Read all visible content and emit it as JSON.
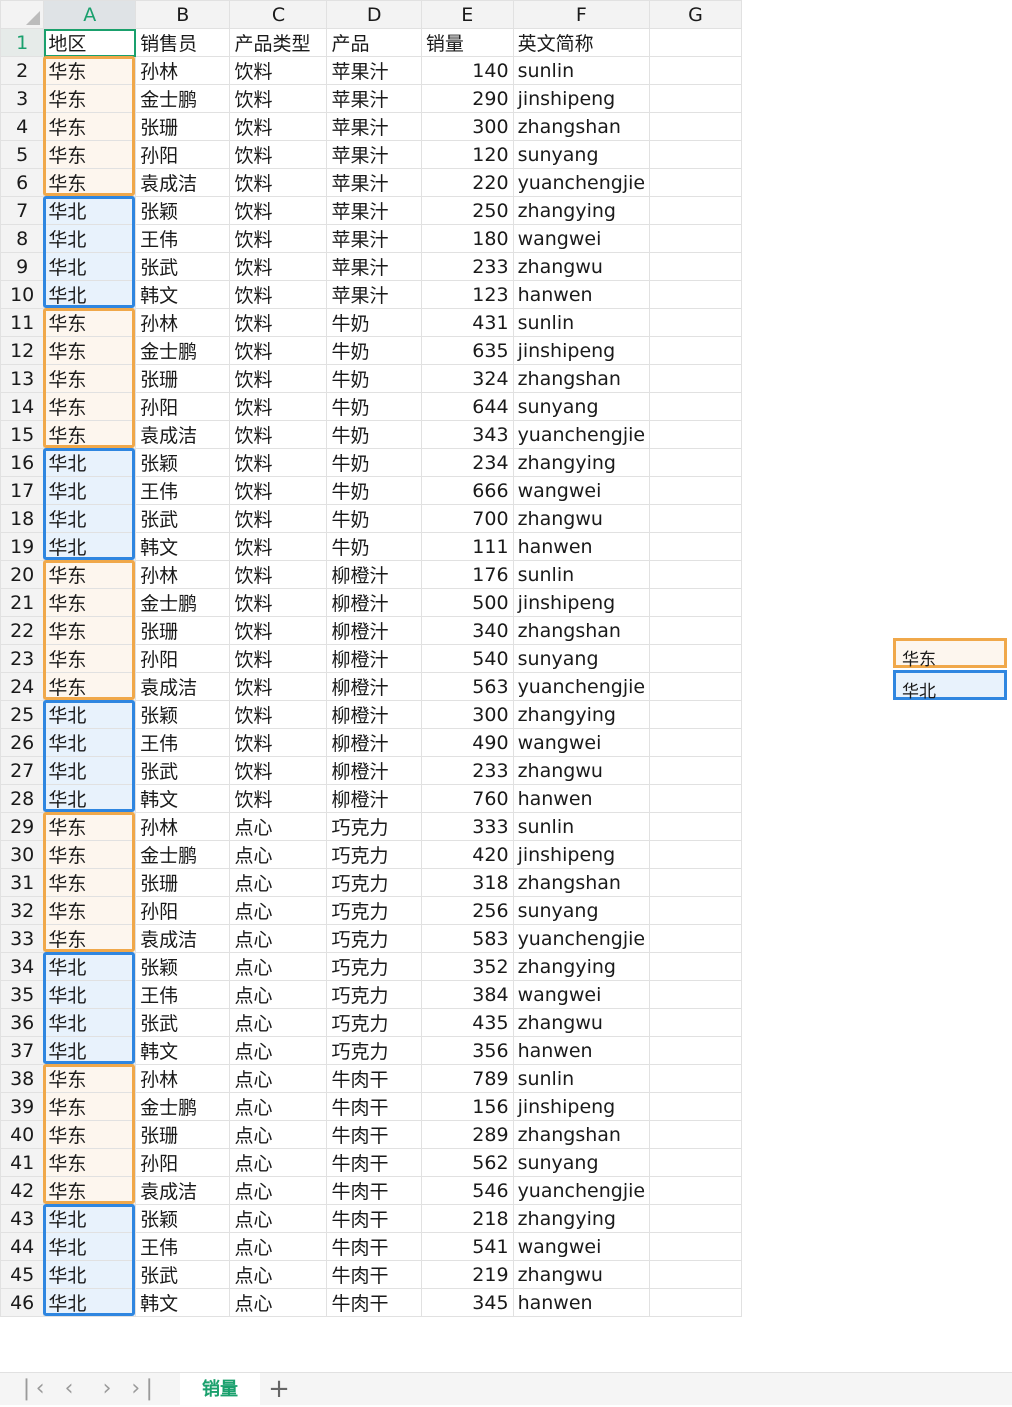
{
  "columns": [
    "A",
    "B",
    "C",
    "D",
    "E",
    "F",
    "G"
  ],
  "header": [
    "地区",
    "销售员",
    "产品类型",
    "产品",
    "销量",
    "英文简称",
    ""
  ],
  "rows": [
    [
      "华东",
      "孙林",
      "饮料",
      "苹果汁",
      "140",
      "sunlin"
    ],
    [
      "华东",
      "金士鹏",
      "饮料",
      "苹果汁",
      "290",
      "jinshipeng"
    ],
    [
      "华东",
      "张珊",
      "饮料",
      "苹果汁",
      "300",
      "zhangshan"
    ],
    [
      "华东",
      "孙阳",
      "饮料",
      "苹果汁",
      "120",
      "sunyang"
    ],
    [
      "华东",
      "袁成洁",
      "饮料",
      "苹果汁",
      "220",
      "yuanchengjie"
    ],
    [
      "华北",
      "张颖",
      "饮料",
      "苹果汁",
      "250",
      "zhangying"
    ],
    [
      "华北",
      "王伟",
      "饮料",
      "苹果汁",
      "180",
      "wangwei"
    ],
    [
      "华北",
      "张武",
      "饮料",
      "苹果汁",
      "233",
      "zhangwu"
    ],
    [
      "华北",
      "韩文",
      "饮料",
      "苹果汁",
      "123",
      "hanwen"
    ],
    [
      "华东",
      "孙林",
      "饮料",
      "牛奶",
      "431",
      "sunlin"
    ],
    [
      "华东",
      "金士鹏",
      "饮料",
      "牛奶",
      "635",
      "jinshipeng"
    ],
    [
      "华东",
      "张珊",
      "饮料",
      "牛奶",
      "324",
      "zhangshan"
    ],
    [
      "华东",
      "孙阳",
      "饮料",
      "牛奶",
      "644",
      "sunyang"
    ],
    [
      "华东",
      "袁成洁",
      "饮料",
      "牛奶",
      "343",
      "yuanchengjie"
    ],
    [
      "华北",
      "张颖",
      "饮料",
      "牛奶",
      "234",
      "zhangying"
    ],
    [
      "华北",
      "王伟",
      "饮料",
      "牛奶",
      "666",
      "wangwei"
    ],
    [
      "华北",
      "张武",
      "饮料",
      "牛奶",
      "700",
      "zhangwu"
    ],
    [
      "华北",
      "韩文",
      "饮料",
      "牛奶",
      "111",
      "hanwen"
    ],
    [
      "华东",
      "孙林",
      "饮料",
      "柳橙汁",
      "176",
      "sunlin"
    ],
    [
      "华东",
      "金士鹏",
      "饮料",
      "柳橙汁",
      "500",
      "jinshipeng"
    ],
    [
      "华东",
      "张珊",
      "饮料",
      "柳橙汁",
      "340",
      "zhangshan"
    ],
    [
      "华东",
      "孙阳",
      "饮料",
      "柳橙汁",
      "540",
      "sunyang"
    ],
    [
      "华东",
      "袁成洁",
      "饮料",
      "柳橙汁",
      "563",
      "yuanchengjie"
    ],
    [
      "华北",
      "张颖",
      "饮料",
      "柳橙汁",
      "300",
      "zhangying"
    ],
    [
      "华北",
      "王伟",
      "饮料",
      "柳橙汁",
      "490",
      "wangwei"
    ],
    [
      "华北",
      "张武",
      "饮料",
      "柳橙汁",
      "233",
      "zhangwu"
    ],
    [
      "华北",
      "韩文",
      "饮料",
      "柳橙汁",
      "760",
      "hanwen"
    ],
    [
      "华东",
      "孙林",
      "点心",
      "巧克力",
      "333",
      "sunlin"
    ],
    [
      "华东",
      "金士鹏",
      "点心",
      "巧克力",
      "420",
      "jinshipeng"
    ],
    [
      "华东",
      "张珊",
      "点心",
      "巧克力",
      "318",
      "zhangshan"
    ],
    [
      "华东",
      "孙阳",
      "点心",
      "巧克力",
      "256",
      "sunyang"
    ],
    [
      "华东",
      "袁成洁",
      "点心",
      "巧克力",
      "583",
      "yuanchengjie"
    ],
    [
      "华北",
      "张颖",
      "点心",
      "巧克力",
      "352",
      "zhangying"
    ],
    [
      "华北",
      "王伟",
      "点心",
      "巧克力",
      "384",
      "wangwei"
    ],
    [
      "华北",
      "张武",
      "点心",
      "巧克力",
      "435",
      "zhangwu"
    ],
    [
      "华北",
      "韩文",
      "点心",
      "巧克力",
      "356",
      "hanwen"
    ],
    [
      "华东",
      "孙林",
      "点心",
      "牛肉干",
      "789",
      "sunlin"
    ],
    [
      "华东",
      "金士鹏",
      "点心",
      "牛肉干",
      "156",
      "jinshipeng"
    ],
    [
      "华东",
      "张珊",
      "点心",
      "牛肉干",
      "289",
      "zhangshan"
    ],
    [
      "华东",
      "孙阳",
      "点心",
      "牛肉干",
      "562",
      "sunyang"
    ],
    [
      "华东",
      "袁成洁",
      "点心",
      "牛肉干",
      "546",
      "yuanchengjie"
    ],
    [
      "华北",
      "张颖",
      "点心",
      "牛肉干",
      "218",
      "zhangying"
    ],
    [
      "华北",
      "王伟",
      "点心",
      "牛肉干",
      "541",
      "wangwei"
    ],
    [
      "华北",
      "张武",
      "点心",
      "牛肉干",
      "219",
      "zhangwu"
    ],
    [
      "华北",
      "韩文",
      "点心",
      "牛肉干",
      "345",
      "hanwen"
    ]
  ],
  "legend": {
    "east": "华东",
    "north": "华北"
  },
  "colors": {
    "east_border": "#f0a84a",
    "east_fill": "#fdf6ee",
    "north_border": "#2f86e0",
    "north_fill": "#e8f2fc",
    "accent": "#1aa06d"
  },
  "active_cell": "A1",
  "tabs": {
    "sheet_name": "销量",
    "add_label": "+",
    "nav_first": "|<",
    "nav_prev": "<",
    "nav_next": ">",
    "nav_last": ">|"
  }
}
